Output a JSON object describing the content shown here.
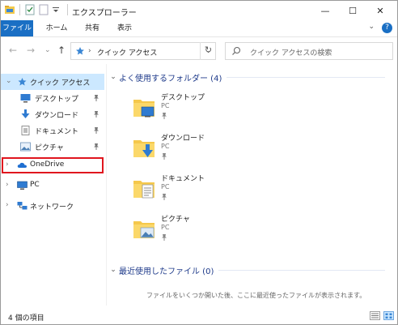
{
  "window": {
    "title": "エクスプローラー",
    "minimize": "—",
    "maximize": "☐",
    "close": "✕"
  },
  "ribbon": {
    "tabs": [
      {
        "label": "ファイル",
        "active": true
      },
      {
        "label": "ホーム"
      },
      {
        "label": "共有"
      },
      {
        "label": "表示"
      }
    ],
    "help": "?",
    "collapse": "⌄"
  },
  "address": {
    "back": "←",
    "forward": "→",
    "recent": "⌄",
    "up": "↑",
    "crumb_sep": "›",
    "location": "クイック アクセス",
    "dropdown": "⌄",
    "refresh": "↻",
    "search_placeholder": "クイック アクセスの検索"
  },
  "nav": {
    "expand_open": "⌄",
    "expand_closed": "›",
    "pin": "📌",
    "items": [
      {
        "label": "クイック アクセス",
        "icon": "star-icon",
        "selected": true
      },
      {
        "label": "デスクトップ",
        "icon": "desktop-icon",
        "pinned": true
      },
      {
        "label": "ダウンロード",
        "icon": "download-icon",
        "pinned": true
      },
      {
        "label": "ドキュメント",
        "icon": "document-icon",
        "pinned": true
      },
      {
        "label": "ピクチャ",
        "icon": "pictures-icon",
        "pinned": true
      },
      {
        "label": "OneDrive",
        "icon": "cloud-icon",
        "highlighted": true
      },
      {
        "label": "PC",
        "icon": "pc-icon"
      },
      {
        "label": "ネットワーク",
        "icon": "network-icon"
      }
    ]
  },
  "content": {
    "frequent": {
      "chevron": "⌄",
      "title": "よく使用するフォルダー (4)",
      "folders": [
        {
          "name": "デスクトップ",
          "location": "PC",
          "pin": "📌",
          "icon": "desktop-folder-icon"
        },
        {
          "name": "ダウンロード",
          "location": "PC",
          "pin": "📌",
          "icon": "download-folder-icon"
        },
        {
          "name": "ドキュメント",
          "location": "PC",
          "pin": "📌",
          "icon": "document-folder-icon"
        },
        {
          "name": "ピクチャ",
          "location": "PC",
          "pin": "📌",
          "icon": "pictures-folder-icon"
        }
      ]
    },
    "recent": {
      "chevron": "⌄",
      "title": "最近使用したファイル (0)",
      "message": "ファイルをいくつか開いた後、ここに最近使ったファイルが表示されます。"
    }
  },
  "status": {
    "count": "4 個の項目"
  },
  "colors": {
    "accent": "#1a6fc4",
    "selected_bg": "#cce8ff",
    "highlight_border": "#e0161e",
    "group_title": "#1e3a8a"
  }
}
